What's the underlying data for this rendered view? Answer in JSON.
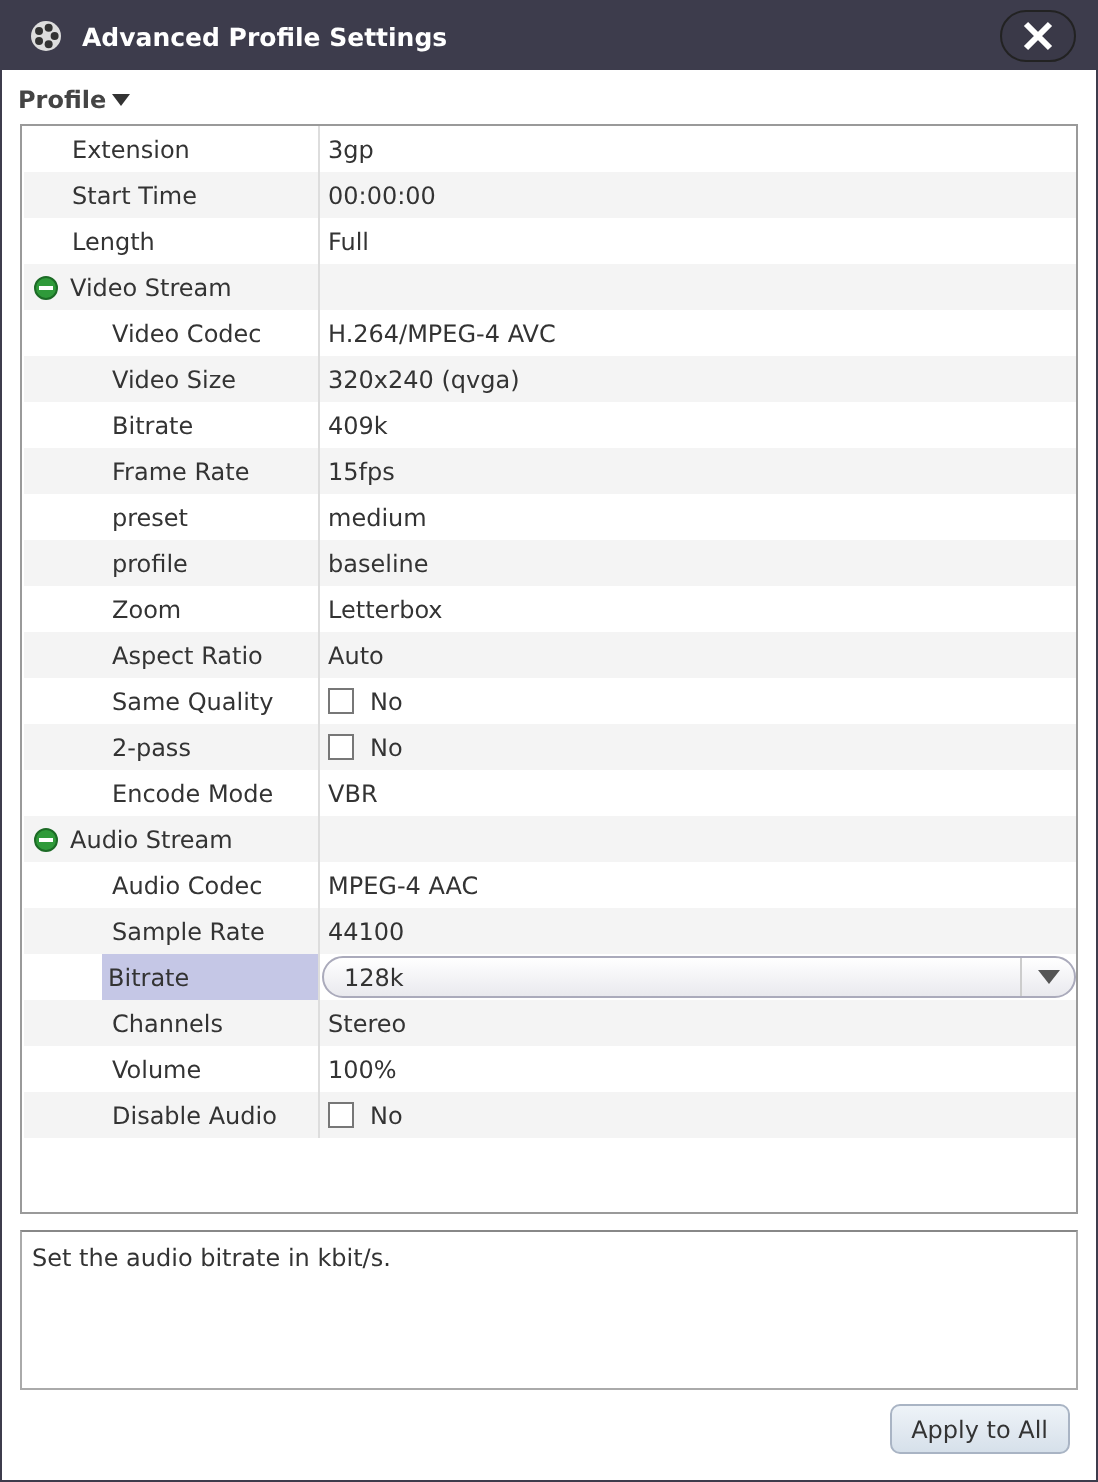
{
  "window": {
    "title": "Advanced Profile Settings"
  },
  "profile_menu": {
    "label": "Profile"
  },
  "properties": [
    {
      "kind": "text",
      "label": "Extension",
      "value": "3gp",
      "selected": false
    },
    {
      "kind": "text",
      "label": "Start Time",
      "value": "00:00:00",
      "selected": false
    },
    {
      "kind": "text",
      "label": "Length",
      "value": "Full",
      "selected": false
    },
    {
      "kind": "group",
      "label": "Video Stream",
      "expanded": true,
      "selected": false,
      "children": [
        {
          "kind": "text",
          "label": "Video Codec",
          "value": "H.264/MPEG-4 AVC",
          "selected": false
        },
        {
          "kind": "text",
          "label": "Video Size",
          "value": "320x240 (qvga)",
          "selected": false
        },
        {
          "kind": "text",
          "label": "Bitrate",
          "value": "409k",
          "selected": false
        },
        {
          "kind": "text",
          "label": "Frame Rate",
          "value": "15fps",
          "selected": false
        },
        {
          "kind": "text",
          "label": "preset",
          "value": "medium",
          "selected": false
        },
        {
          "kind": "text",
          "label": "profile",
          "value": "baseline",
          "selected": false
        },
        {
          "kind": "text",
          "label": "Zoom",
          "value": "Letterbox",
          "selected": false
        },
        {
          "kind": "text",
          "label": "Aspect Ratio",
          "value": "Auto",
          "selected": false
        },
        {
          "kind": "checkbox",
          "label": "Same Quality",
          "value": "No",
          "checked": false,
          "selected": false
        },
        {
          "kind": "checkbox",
          "label": "2-pass",
          "value": "No",
          "checked": false,
          "selected": false
        },
        {
          "kind": "text",
          "label": "Encode Mode",
          "value": "VBR",
          "selected": false
        }
      ]
    },
    {
      "kind": "group",
      "label": "Audio Stream",
      "expanded": true,
      "selected": false,
      "children": [
        {
          "kind": "text",
          "label": "Audio Codec",
          "value": "MPEG-4 AAC",
          "selected": false
        },
        {
          "kind": "text",
          "label": "Sample Rate",
          "value": "44100",
          "selected": false
        },
        {
          "kind": "dropdown",
          "label": "Bitrate",
          "value": "128k",
          "selected": true
        },
        {
          "kind": "text",
          "label": "Channels",
          "value": "Stereo",
          "selected": false
        },
        {
          "kind": "text",
          "label": "Volume",
          "value": "100%",
          "selected": false
        },
        {
          "kind": "checkbox",
          "label": "Disable Audio",
          "value": "No",
          "checked": false,
          "selected": false
        }
      ]
    }
  ],
  "description": "Set the audio bitrate in kbit/s.",
  "buttons": [
    {
      "label": "Apply to All"
    }
  ]
}
